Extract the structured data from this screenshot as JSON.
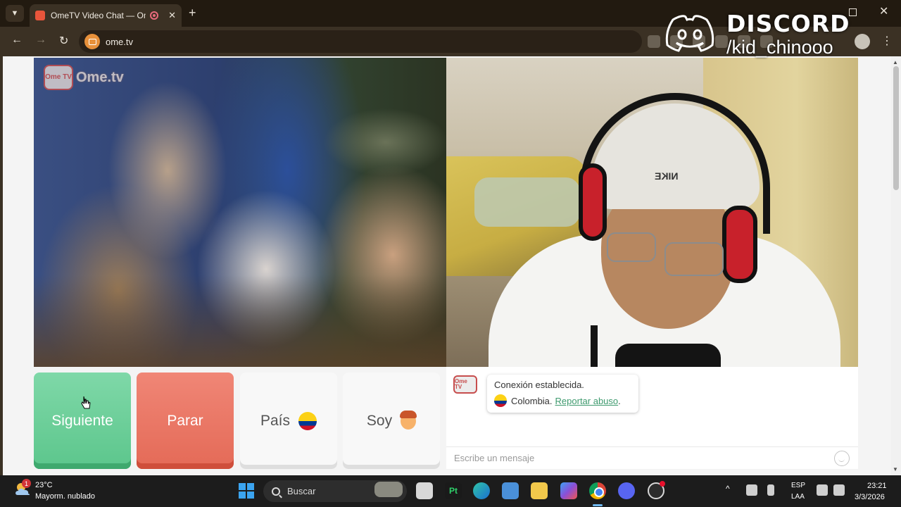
{
  "browser": {
    "tab_title": "OmeTV Video Chat — Ome",
    "url": "ome.tv"
  },
  "overlay": {
    "brand": "DISCORD",
    "username": "/kid_chinooo"
  },
  "stranger": {
    "watermark_badge": "Ome TV",
    "watermark_text": "Ome.tv"
  },
  "self_video": {
    "cap_text": "NIKE"
  },
  "controls": {
    "next_label": "Siguiente",
    "stop_label": "Parar",
    "country_label": "País",
    "gender_label": "Soy"
  },
  "chat": {
    "avatar": "Ome TV",
    "status": "Conexión establecida.",
    "country": "Colombia.",
    "report_link": "Reportar abuso",
    "report_suffix": ".",
    "input_placeholder": "Escribe un mensaje"
  },
  "taskbar": {
    "weather_badge": "1",
    "temperature": "23°C",
    "weather": "Mayorm. nublado",
    "search_label": "Buscar",
    "pt_label": "Pt",
    "lang_line1": "ESP",
    "lang_line2": "LAA",
    "time": "23:21",
    "date": "3/3/2026"
  },
  "colors": {
    "next": "#5cc68c",
    "stop": "#e46a57",
    "link": "#3e9a6e",
    "discord": "#5865f2"
  }
}
